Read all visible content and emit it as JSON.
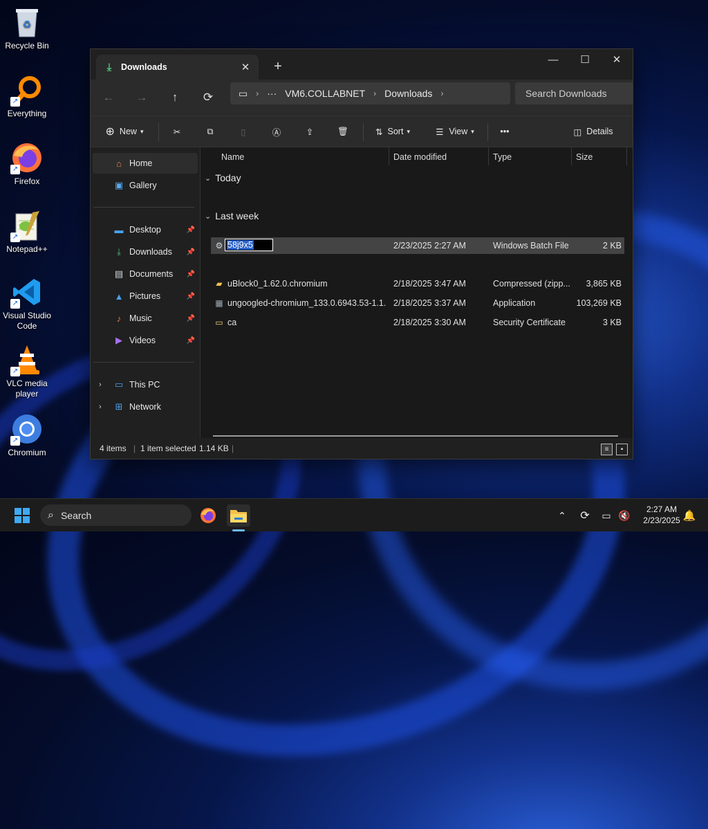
{
  "desktop": {
    "icons": [
      {
        "label": "Recycle Bin",
        "icon": "recycle-bin-icon"
      },
      {
        "label": "Everything",
        "icon": "everything-search-icon"
      },
      {
        "label": "Firefox",
        "icon": "firefox-icon"
      },
      {
        "label": "Notepad++",
        "icon": "notepad-plus-plus-icon"
      },
      {
        "label": "Visual Studio Code",
        "icon": "vscode-icon"
      },
      {
        "label": "VLC media player",
        "icon": "vlc-icon"
      },
      {
        "label": "Chromium",
        "icon": "chromium-icon"
      }
    ]
  },
  "window": {
    "tab_title": "Downloads",
    "nav": {
      "breadcrumbs": [
        "VM6.COLLABNET",
        "Downloads"
      ],
      "search_placeholder": "Search Downloads"
    },
    "toolbar": {
      "new_label": "New",
      "sort_label": "Sort",
      "view_label": "View",
      "more_label": "•••",
      "details_label": "Details"
    },
    "nav_pane": {
      "quick": [
        {
          "label": "Home",
          "icon": "home-icon",
          "selected": true
        },
        {
          "label": "Gallery",
          "icon": "gallery-icon"
        }
      ],
      "pinned": [
        {
          "label": "Desktop",
          "icon": "desktop-folder-icon"
        },
        {
          "label": "Downloads",
          "icon": "downloads-folder-icon"
        },
        {
          "label": "Documents",
          "icon": "documents-folder-icon"
        },
        {
          "label": "Pictures",
          "icon": "pictures-folder-icon"
        },
        {
          "label": "Music",
          "icon": "music-folder-icon"
        },
        {
          "label": "Videos",
          "icon": "videos-folder-icon"
        }
      ],
      "locations": [
        {
          "label": "This PC",
          "icon": "this-pc-icon"
        },
        {
          "label": "Network",
          "icon": "network-icon"
        }
      ]
    },
    "columns": {
      "name": "Name",
      "date": "Date modified",
      "type": "Type",
      "size": "Size"
    },
    "groups": [
      {
        "label": "Today",
        "rows": [
          {
            "name": "58j9x5",
            "date": "2/23/2025 2:27 AM",
            "type": "Windows Batch File",
            "size": "2 KB",
            "icon": "batch-file-icon",
            "selected": true,
            "renaming": true
          }
        ]
      },
      {
        "label": "Last week",
        "rows": [
          {
            "name": "uBlock0_1.62.0.chromium",
            "date": "2/18/2025 3:47 AM",
            "type": "Compressed (zipp...",
            "size": "3,865 KB",
            "icon": "zip-folder-icon"
          },
          {
            "name": "ungoogled-chromium_133.0.6943.53-1.1...",
            "date": "2/18/2025 3:37 AM",
            "type": "Application",
            "size": "103,269 KB",
            "icon": "application-icon"
          },
          {
            "name": "ca",
            "date": "2/18/2025 3:30 AM",
            "type": "Security Certificate",
            "size": "3 KB",
            "icon": "certificate-icon"
          }
        ]
      }
    ],
    "status": {
      "items": "4 items",
      "selection": "1 item selected",
      "size": "1.14 KB"
    }
  },
  "taskbar": {
    "search_label": "Search",
    "time": "2:27 AM",
    "date": "2/23/2025"
  },
  "colors": {
    "accent": "#2a62c9",
    "window_bg": "#191919",
    "pane_bg": "#202020",
    "selected_row": "#444444"
  }
}
